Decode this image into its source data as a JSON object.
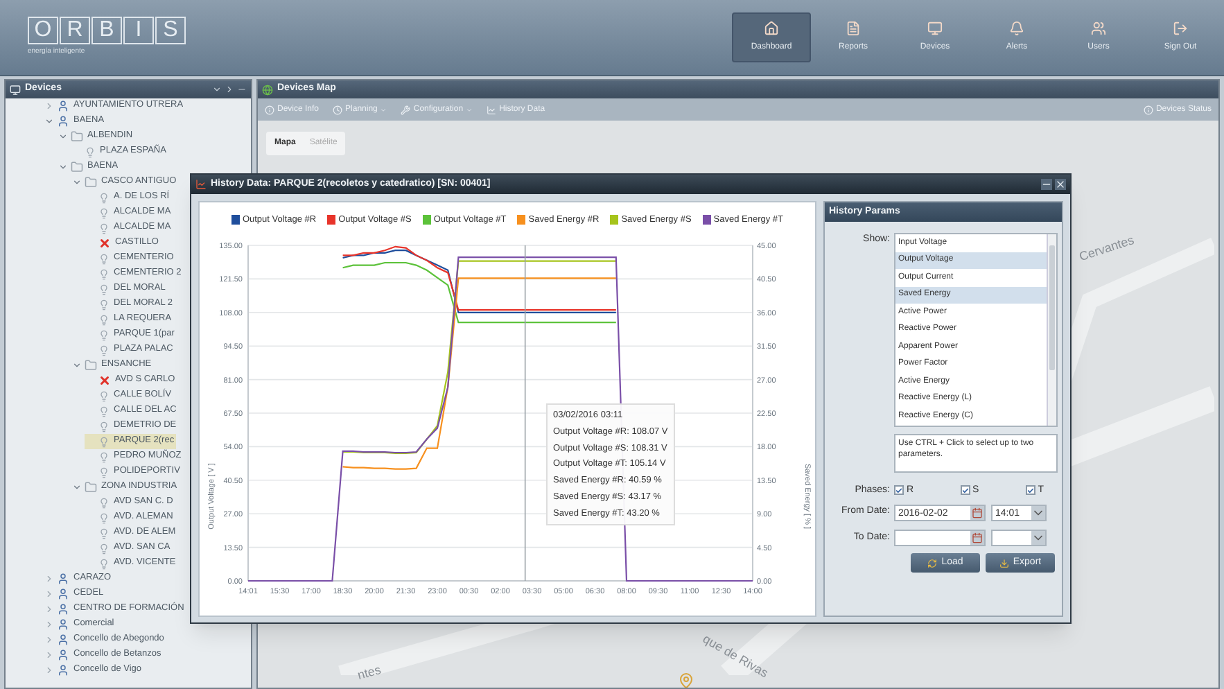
{
  "app": {
    "logo": [
      "O",
      "R",
      "B",
      "I",
      "S"
    ],
    "tagline": "energía inteligente"
  },
  "nav": [
    {
      "label": "Dashboard",
      "selected": true
    },
    {
      "label": "Reports",
      "selected": false
    },
    {
      "label": "Devices",
      "selected": false
    },
    {
      "label": "Alerts",
      "selected": false
    },
    {
      "label": "Users",
      "selected": false
    },
    {
      "label": "Sign Out",
      "selected": false
    }
  ],
  "devices_panel": {
    "title": "Devices",
    "tree": [
      {
        "label": "AYUNTAMIENTO UTRERA",
        "kind": "group",
        "expanded": false,
        "selected": false
      },
      {
        "label": "BAENA",
        "kind": "group",
        "expanded": true,
        "selected": false,
        "children": [
          {
            "label": "ALBENDIN",
            "kind": "folder",
            "expanded": true,
            "selected": false,
            "children": [
              {
                "label": "PLAZA ESPAÑA",
                "kind": "lamp",
                "selected": false
              }
            ]
          },
          {
            "label": "BAENA",
            "kind": "folder",
            "expanded": true,
            "selected": false,
            "children": [
              {
                "label": "CASCO ANTIGUO",
                "kind": "folder",
                "expanded": true,
                "selected": false,
                "children": [
                  {
                    "label": "A. DE LOS RÍ",
                    "kind": "lamp",
                    "selected": false
                  },
                  {
                    "label": "ALCALDE MA",
                    "kind": "lamp",
                    "selected": false
                  },
                  {
                    "label": "ALCALDE MA",
                    "kind": "lamp",
                    "selected": false
                  },
                  {
                    "label": "CASTILLO",
                    "kind": "alarm",
                    "selected": false
                  },
                  {
                    "label": "CEMENTERIO",
                    "kind": "lamp",
                    "selected": false
                  },
                  {
                    "label": "CEMENTERIO 2",
                    "kind": "lamp",
                    "selected": false
                  },
                  {
                    "label": "DEL MORAL",
                    "kind": "lamp",
                    "selected": false
                  },
                  {
                    "label": "DEL MORAL 2",
                    "kind": "lamp",
                    "selected": false
                  },
                  {
                    "label": "LA REQUERA",
                    "kind": "lamp",
                    "selected": false
                  },
                  {
                    "label": "PARQUE 1(par",
                    "kind": "lamp",
                    "selected": false
                  },
                  {
                    "label": "PLAZA PALAC",
                    "kind": "lamp",
                    "selected": false
                  }
                ]
              },
              {
                "label": "ENSANCHE",
                "kind": "folder",
                "expanded": true,
                "selected": false,
                "children": [
                  {
                    "label": "AVD S CARLO",
                    "kind": "alarm",
                    "selected": false
                  },
                  {
                    "label": "CALLE BOLÍV",
                    "kind": "lamp",
                    "selected": false
                  },
                  {
                    "label": "CALLE DEL AC",
                    "kind": "lamp",
                    "selected": false
                  },
                  {
                    "label": "DEMETRIO DE",
                    "kind": "lamp",
                    "selected": false
                  },
                  {
                    "label": "PARQUE 2(rec",
                    "kind": "lamp",
                    "selected": true
                  },
                  {
                    "label": "PEDRO MUÑOZ",
                    "kind": "lamp",
                    "selected": false
                  },
                  {
                    "label": "POLIDEPORTIV",
                    "kind": "lamp",
                    "selected": false
                  }
                ]
              },
              {
                "label": "ZONA INDUSTRIA",
                "kind": "folder",
                "expanded": true,
                "selected": false,
                "children": [
                  {
                    "label": "AVD SAN C. D",
                    "kind": "lamp",
                    "selected": false
                  },
                  {
                    "label": "AVD. ALEMAN",
                    "kind": "lamp",
                    "selected": false
                  },
                  {
                    "label": "AVD. DE ALEM",
                    "kind": "lamp",
                    "selected": false
                  },
                  {
                    "label": "AVD. SAN CA",
                    "kind": "lamp",
                    "selected": false
                  },
                  {
                    "label": "AVD. VICENTE",
                    "kind": "lamp",
                    "selected": false
                  }
                ]
              }
            ]
          }
        ]
      },
      {
        "label": "CARAZO",
        "kind": "group",
        "expanded": false,
        "selected": false
      },
      {
        "label": "CEDEL",
        "kind": "group",
        "expanded": false,
        "selected": false
      },
      {
        "label": "CENTRO DE FORMACIÓN",
        "kind": "group",
        "expanded": false,
        "selected": false
      },
      {
        "label": "Comercial",
        "kind": "group",
        "expanded": false,
        "selected": false
      },
      {
        "label": "Concello de Abegondo",
        "kind": "group",
        "expanded": false,
        "selected": false
      },
      {
        "label": "Concello de Betanzos",
        "kind": "group",
        "expanded": false,
        "selected": false
      },
      {
        "label": "Concello de Vigo",
        "kind": "group",
        "expanded": false,
        "selected": false
      }
    ]
  },
  "map_panel": {
    "title": "Devices Map",
    "toolbar": [
      {
        "label": "Device Info",
        "dropdown": false
      },
      {
        "label": "Planning",
        "dropdown": true
      },
      {
        "label": "Configuration",
        "dropdown": true
      },
      {
        "label": "History Data",
        "dropdown": false
      }
    ],
    "status_button": "Devices Status",
    "tabs": [
      {
        "label": "Mapa",
        "selected": true
      },
      {
        "label": "Satélite",
        "selected": false
      }
    ],
    "street_labels": [
      "Cervantes",
      "que de Rivas",
      "ntes"
    ]
  },
  "history_window": {
    "title": "History Data: PARQUE 2(recoletos y catedratico) [SN: 00401]",
    "chart_data": {
      "type": "line",
      "ylabel": "Output Voltage [ V ]",
      "y2label": "Saved Energy [ % ]",
      "categories": [
        "14:01",
        null,
        null,
        "15:30",
        null,
        null,
        "17:00",
        null,
        null,
        "18:30",
        null,
        null,
        "20:00",
        null,
        null,
        "21:30",
        null,
        null,
        "23:00",
        null,
        null,
        "00:30",
        null,
        null,
        "02:00",
        null,
        null,
        "03:30",
        null,
        null,
        "05:00",
        null,
        null,
        "06:30",
        null,
        null,
        "08:00",
        null,
        null,
        "09:30",
        null,
        null,
        "11:00",
        null,
        null,
        "12:30",
        null,
        null,
        "14:00"
      ],
      "ylim": [
        0,
        135
      ],
      "y2lim": [
        0,
        45
      ],
      "yticks": [
        {
          "value": 0,
          "label": "0.00"
        },
        {
          "value": 13.5,
          "label": "13.50"
        },
        {
          "value": 27,
          "label": "27.00"
        },
        {
          "value": 40.5,
          "label": "40.50"
        },
        {
          "value": 54,
          "label": "54.00"
        },
        {
          "value": 67.5,
          "label": "67.50"
        },
        {
          "value": 81,
          "label": "81.00"
        },
        {
          "value": 94.5,
          "label": "94.50"
        },
        {
          "value": 108,
          "label": "108.00"
        },
        {
          "value": 121.5,
          "label": "121.50"
        },
        {
          "value": 135,
          "label": "135.00"
        }
      ],
      "y2ticks": [
        {
          "value": 0,
          "label": "0.00"
        },
        {
          "value": 4.5,
          "label": "4.50"
        },
        {
          "value": 9,
          "label": "9.00"
        },
        {
          "value": 13.5,
          "label": "13.50"
        },
        {
          "value": 18,
          "label": "18.00"
        },
        {
          "value": 22.5,
          "label": "22.50"
        },
        {
          "value": 27,
          "label": "27.00"
        },
        {
          "value": 31.5,
          "label": "31.50"
        },
        {
          "value": 36,
          "label": "36.00"
        },
        {
          "value": 40.5,
          "label": "40.50"
        },
        {
          "value": 45,
          "label": "45.00"
        }
      ],
      "series": [
        {
          "name": "Output Voltage #R",
          "color": "#1f4e9c",
          "values": [
            null,
            null,
            null,
            null,
            null,
            null,
            null,
            null,
            null,
            130,
            131,
            131,
            132,
            132,
            133,
            133,
            131,
            129,
            127,
            125,
            108,
            108,
            108,
            108,
            108,
            108,
            108,
            108,
            108,
            108,
            108,
            108,
            108,
            108,
            108,
            108,
            null,
            null,
            null,
            null,
            null,
            null,
            null,
            null,
            null,
            null,
            null,
            null,
            null
          ]
        },
        {
          "name": "Output Voltage #S",
          "color": "#e8342a",
          "values": [
            null,
            null,
            null,
            null,
            null,
            null,
            null,
            null,
            null,
            131,
            131,
            132,
            132,
            133,
            134.5,
            134,
            131,
            129,
            126,
            124,
            109,
            109,
            109,
            109,
            109,
            109,
            109,
            109,
            109,
            109,
            109,
            109,
            109,
            109,
            109,
            109,
            null,
            null,
            null,
            null,
            null,
            null,
            null,
            null,
            null,
            null,
            null,
            null,
            null
          ]
        },
        {
          "name": "Output Voltage #T",
          "color": "#5cc23a",
          "values": [
            null,
            null,
            null,
            null,
            null,
            null,
            null,
            null,
            null,
            126,
            127,
            127,
            127,
            128,
            128,
            128,
            127,
            125,
            122,
            119,
            104,
            104,
            104,
            104,
            104,
            104,
            104,
            104,
            104,
            104,
            104,
            104,
            104,
            104,
            104,
            104,
            null,
            null,
            null,
            null,
            null,
            null,
            null,
            null,
            null,
            null,
            null,
            null,
            null
          ]
        },
        {
          "name": "Saved Energy #R",
          "color": "#f7901e",
          "axis": "y2",
          "values": [
            null,
            null,
            null,
            null,
            null,
            null,
            null,
            null,
            null,
            15.3,
            15.2,
            15.2,
            15.1,
            15.1,
            15,
            15,
            15.1,
            17.8,
            17.8,
            26,
            40.6,
            40.6,
            40.6,
            40.6,
            40.6,
            40.6,
            40.6,
            40.6,
            40.6,
            40.6,
            40.6,
            40.6,
            40.6,
            40.6,
            40.6,
            40.6,
            null,
            null,
            null,
            null,
            null,
            null,
            null,
            null,
            null,
            null,
            null,
            null,
            null
          ]
        },
        {
          "name": "Saved Energy #S",
          "color": "#a6c41c",
          "axis": "y2",
          "values": [
            null,
            null,
            null,
            null,
            null,
            null,
            null,
            null,
            null,
            17.3,
            17.3,
            17.2,
            17.2,
            17.2,
            17.1,
            17.1,
            17.2,
            19,
            20.8,
            28,
            42.9,
            42.9,
            42.9,
            42.9,
            42.9,
            42.9,
            42.9,
            42.9,
            42.9,
            42.9,
            42.9,
            42.9,
            42.9,
            42.9,
            42.9,
            42.9,
            null,
            null,
            null,
            null,
            null,
            null,
            null,
            null,
            null,
            null,
            null,
            null,
            null
          ]
        },
        {
          "name": "Saved Energy #T",
          "color": "#7a4fa8",
          "axis": "y2",
          "values": [
            0,
            0,
            0,
            0,
            0,
            0,
            0,
            0,
            0,
            17.4,
            17.4,
            17.3,
            17.3,
            17.3,
            17.2,
            17.2,
            17.3,
            19,
            20.5,
            26,
            43.4,
            43.4,
            43.4,
            43.4,
            43.4,
            43.4,
            43.4,
            43.4,
            43.4,
            43.4,
            43.4,
            43.4,
            43.4,
            43.4,
            43.4,
            43.4,
            0,
            0,
            0,
            0,
            0,
            0,
            0,
            0,
            0,
            0,
            0,
            0,
            0
          ]
        }
      ],
      "grid": true,
      "legend": true
    },
    "tooltip": {
      "title": "03/02/2016 03:11",
      "lines": [
        "Output Voltage #R: 108.07 V",
        "Output Voltage #S: 108.31 V",
        "Output Voltage #T: 105.14 V",
        "Saved Energy #R: 40.59 %",
        "Saved Energy #S: 43.17 %",
        "Saved Energy #T: 43.20 %"
      ]
    },
    "params": {
      "title": "History Params",
      "show_label": "Show:",
      "options": [
        {
          "label": "Input Voltage",
          "selected": false
        },
        {
          "label": "Output Voltage",
          "selected": true
        },
        {
          "label": "Output Current",
          "selected": false
        },
        {
          "label": "Saved Energy",
          "selected": true
        },
        {
          "label": "Active Power",
          "selected": false
        },
        {
          "label": "Reactive Power",
          "selected": false
        },
        {
          "label": "Apparent Power",
          "selected": false
        },
        {
          "label": "Power Factor",
          "selected": false
        },
        {
          "label": "Active Energy",
          "selected": false
        },
        {
          "label": "Reactive Energy (L)",
          "selected": false
        },
        {
          "label": "Reactive Energy (C)",
          "selected": false
        }
      ],
      "hint": "Use CTRL + Click to select up to two parameters.",
      "phases_label": "Phases:",
      "phases": [
        {
          "label": "R",
          "checked": true
        },
        {
          "label": "S",
          "checked": true
        },
        {
          "label": "T",
          "checked": true
        }
      ],
      "from_label": "From Date:",
      "from_date": "2016-02-02",
      "from_time": "14:01",
      "to_label": "To Date:",
      "buttons": [
        "Load",
        "Export"
      ]
    }
  }
}
